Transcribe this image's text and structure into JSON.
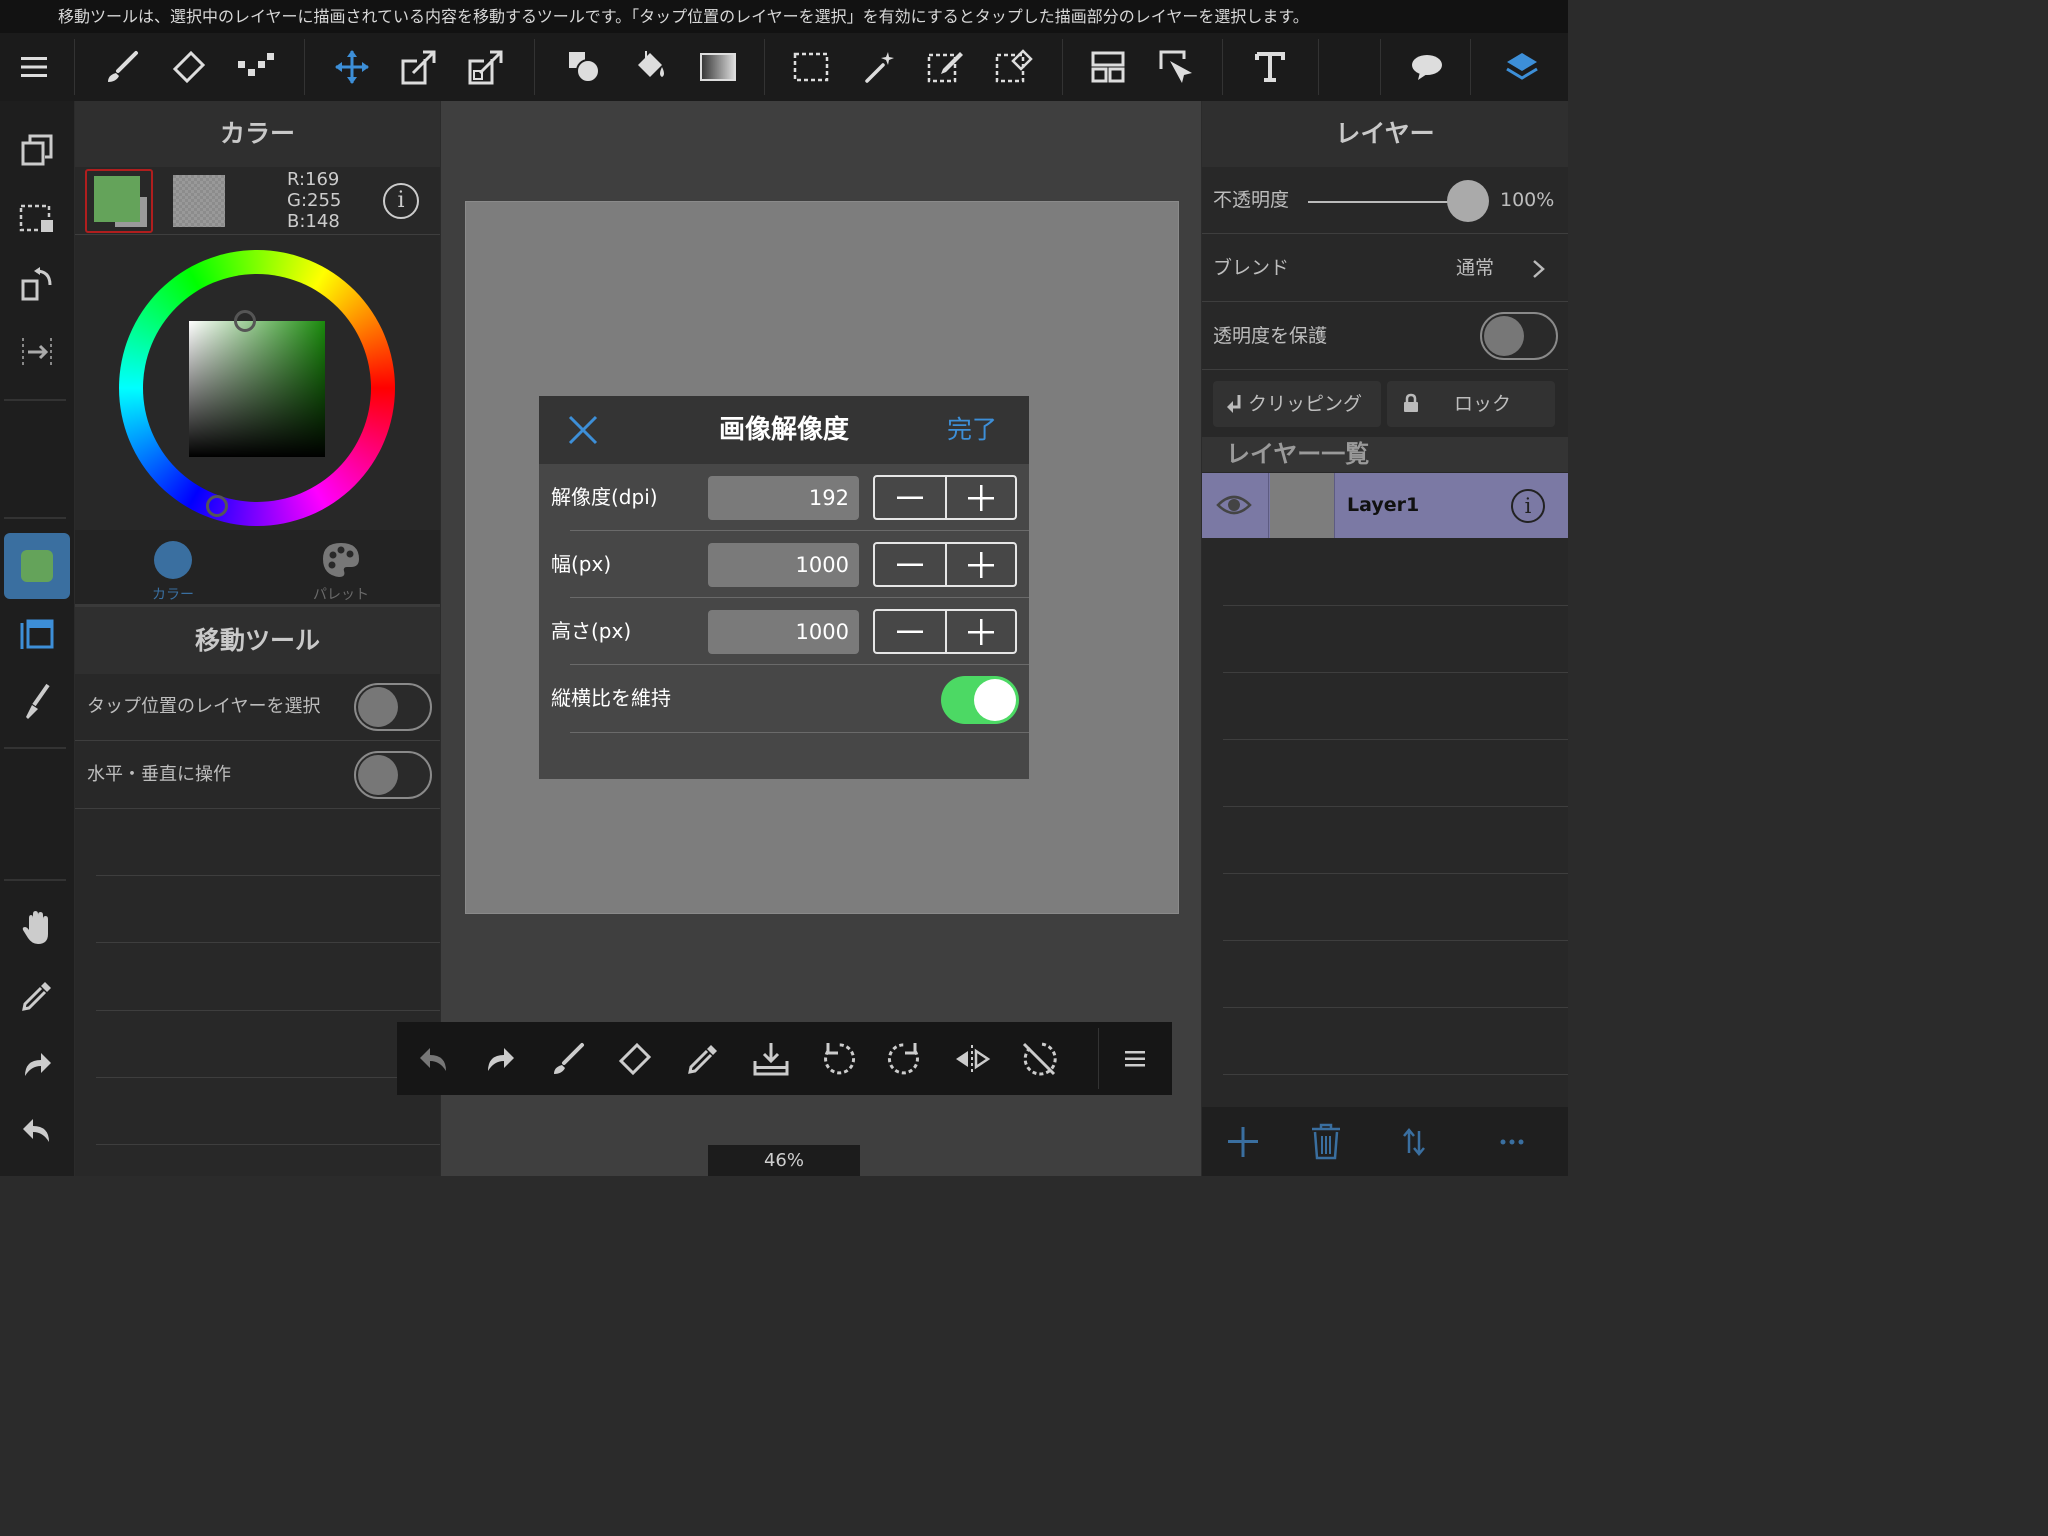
{
  "hint": "移動ツールは、選択中のレイヤーに描画されている内容を移動するツールです。「タップ位置のレイヤーを選択」を有効にするとタップした描画部分のレイヤーを選択します。",
  "toolbar": {
    "tools": [
      "menu-icon",
      "brush-icon",
      "eraser-icon",
      "dot-brush-icon",
      "move-icon",
      "transform-icon",
      "mesh-transform-icon",
      "shape-icon",
      "fill-bucket-icon",
      "gradient-icon",
      "select-rect-icon",
      "magic-wand-icon",
      "select-pen-icon",
      "select-eraser-icon",
      "frame-divider-icon",
      "operation-icon",
      "text-icon",
      "balloon-icon",
      "layers-icon"
    ],
    "accent": "#3d8fd8"
  },
  "color_panel": {
    "title": "カラー",
    "rgb_r": "R:169",
    "rgb_g": "G:255",
    "rgb_b": "B:148",
    "fg_color": "#64a35a",
    "tab_color": "カラー",
    "tab_palette": "パレット"
  },
  "tool_panel": {
    "title": "移動ツール",
    "opt_tap_select": "タップ位置のレイヤーを選択",
    "opt_hv": "水平・垂直に操作"
  },
  "dialog": {
    "title": "画像解像度",
    "done": "完了",
    "rows": [
      {
        "label": "解像度(dpi)",
        "value": "192"
      },
      {
        "label": "幅(px)",
        "value": "1000"
      },
      {
        "label": "高さ(px)",
        "value": "1000"
      }
    ],
    "keep_ratio": "縦横比を維持"
  },
  "zoom": "46%",
  "layer_panel": {
    "title": "レイヤー",
    "opacity_label": "不透明度",
    "opacity_value": "100%",
    "opacity": 1.0,
    "blend_label": "ブレンド",
    "blend_value": "通常",
    "protect_label": "透明度を保護",
    "clipping": "クリッピング",
    "lock": "ロック",
    "list_title": "レイヤー一覧",
    "layer_name": "Layer1"
  }
}
